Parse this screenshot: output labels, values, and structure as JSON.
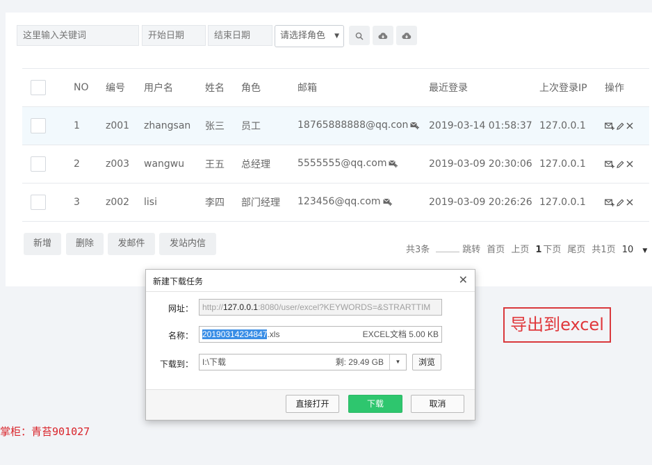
{
  "filters": {
    "keyword_placeholder": "这里输入关键词",
    "start_placeholder": "开始日期",
    "end_placeholder": "结束日期",
    "role_select": "请选择角色"
  },
  "icons": {
    "search": "search-icon",
    "export1": "cloud-download-icon",
    "export2": "cloud-download-icon",
    "mail": "mail-plus-icon",
    "edit": "pencil-icon",
    "delete": "close-icon"
  },
  "table": {
    "headers": [
      "NO",
      "编号",
      "用户名",
      "姓名",
      "角色",
      "邮箱",
      "最近登录",
      "上次登录IP",
      "操作"
    ],
    "rows": [
      {
        "no": "1",
        "code": "z001",
        "username": "zhangsan",
        "name": "张三",
        "role": "员工",
        "email": "18765888888@qq.con",
        "last_login": "2019-03-14 01:58:37",
        "ip": "127.0.0.1"
      },
      {
        "no": "2",
        "code": "z003",
        "username": "wangwu",
        "name": "王五",
        "role": "总经理",
        "email": "5555555@qq.com",
        "last_login": "2019-03-09 20:30:06",
        "ip": "127.0.0.1"
      },
      {
        "no": "3",
        "code": "z002",
        "username": "lisi",
        "name": "李四",
        "role": "部门经理",
        "email": "123456@qq.com",
        "last_login": "2019-03-09 20:26:26",
        "ip": "127.0.0.1"
      }
    ]
  },
  "actions": {
    "add": "新增",
    "delete": "删除",
    "send_mail": "发邮件",
    "send_message": "发站内信"
  },
  "pager": {
    "total": "共3条",
    "jump": "跳转",
    "first": "首页",
    "prev": "上页",
    "current": "1",
    "next": "下页",
    "last": "尾页",
    "pages": "共1页",
    "page_size": "10"
  },
  "dialog": {
    "title": "新建下载任务",
    "url_label": "网址：",
    "url_prefix": "http://",
    "url_host": "127.0.0.1",
    "url_rest": ":8080/user/excel?KEYWORDS=&STRARTTIM",
    "name_label": "名称：",
    "name_selected": "20190314234847",
    "name_ext": ".xls",
    "file_info": "EXCEL文档 5.00 KB",
    "save_label": "下载到：",
    "save_path": "I:\\下载",
    "free_space": "剩: 29.49 GB",
    "browse": "浏览",
    "open_direct": "直接打开",
    "download": "下载",
    "cancel": "取消"
  },
  "annotation": "导出到excel",
  "credit": "掌柜：青苔901027",
  "colors": {
    "accent_green": "#2ec66e",
    "annotation_red": "#d9373b",
    "selection_blue": "#3a8ee6"
  }
}
